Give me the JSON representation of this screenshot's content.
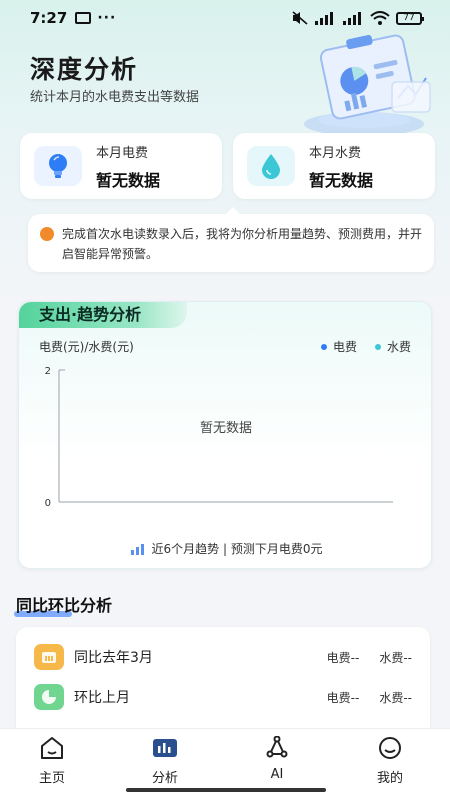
{
  "status_bar": {
    "time": "7:27",
    "dots": "···",
    "battery": "77"
  },
  "header": {
    "title": "深度分析",
    "subtitle": "统计本月的水电费支出等数据"
  },
  "stats": [
    {
      "label": "本月电费",
      "value": "暂无数据",
      "icon": "lightbulb-icon"
    },
    {
      "label": "本月水费",
      "value": "暂无数据",
      "icon": "water-drop-icon"
    }
  ],
  "tip": {
    "text": "完成首次水电读数录入后，我将为你分析用量趋势、预测费用，并开启智能异常预警。"
  },
  "chart_section": {
    "tab_title": "支出·趋势分析",
    "footer": "近6个月趋势 | 预测下月电费0元"
  },
  "chart_data": {
    "type": "line",
    "ylabel": "电费(元)/水费(元)",
    "ylim": [
      0,
      2
    ],
    "yticks": [
      "0",
      "2"
    ],
    "series": [
      {
        "name": "电费",
        "color": "#2f7df6",
        "values": []
      },
      {
        "name": "水费",
        "color": "#3cc7d6",
        "values": []
      }
    ],
    "empty_text": "暂无数据"
  },
  "compare_section": {
    "title": "同比环比分析",
    "rows": [
      {
        "label": "同比去年3月",
        "elec": "电费--",
        "water": "水费--",
        "icon": "calendar-icon"
      },
      {
        "label": "环比上月",
        "elec": "电费--",
        "water": "水费--",
        "icon": "pie-chart-icon"
      }
    ]
  },
  "tabs": [
    {
      "label": "主页",
      "icon": "home-icon"
    },
    {
      "label": "分析",
      "icon": "bar-chart-icon"
    },
    {
      "label": "AI",
      "icon": "ai-icon"
    },
    {
      "label": "我的",
      "icon": "profile-icon"
    }
  ],
  "colors": {
    "accent": "#2f7df6",
    "water": "#3cc7d6",
    "green": "#54d39c",
    "active_tab": "#2a4f8f"
  }
}
